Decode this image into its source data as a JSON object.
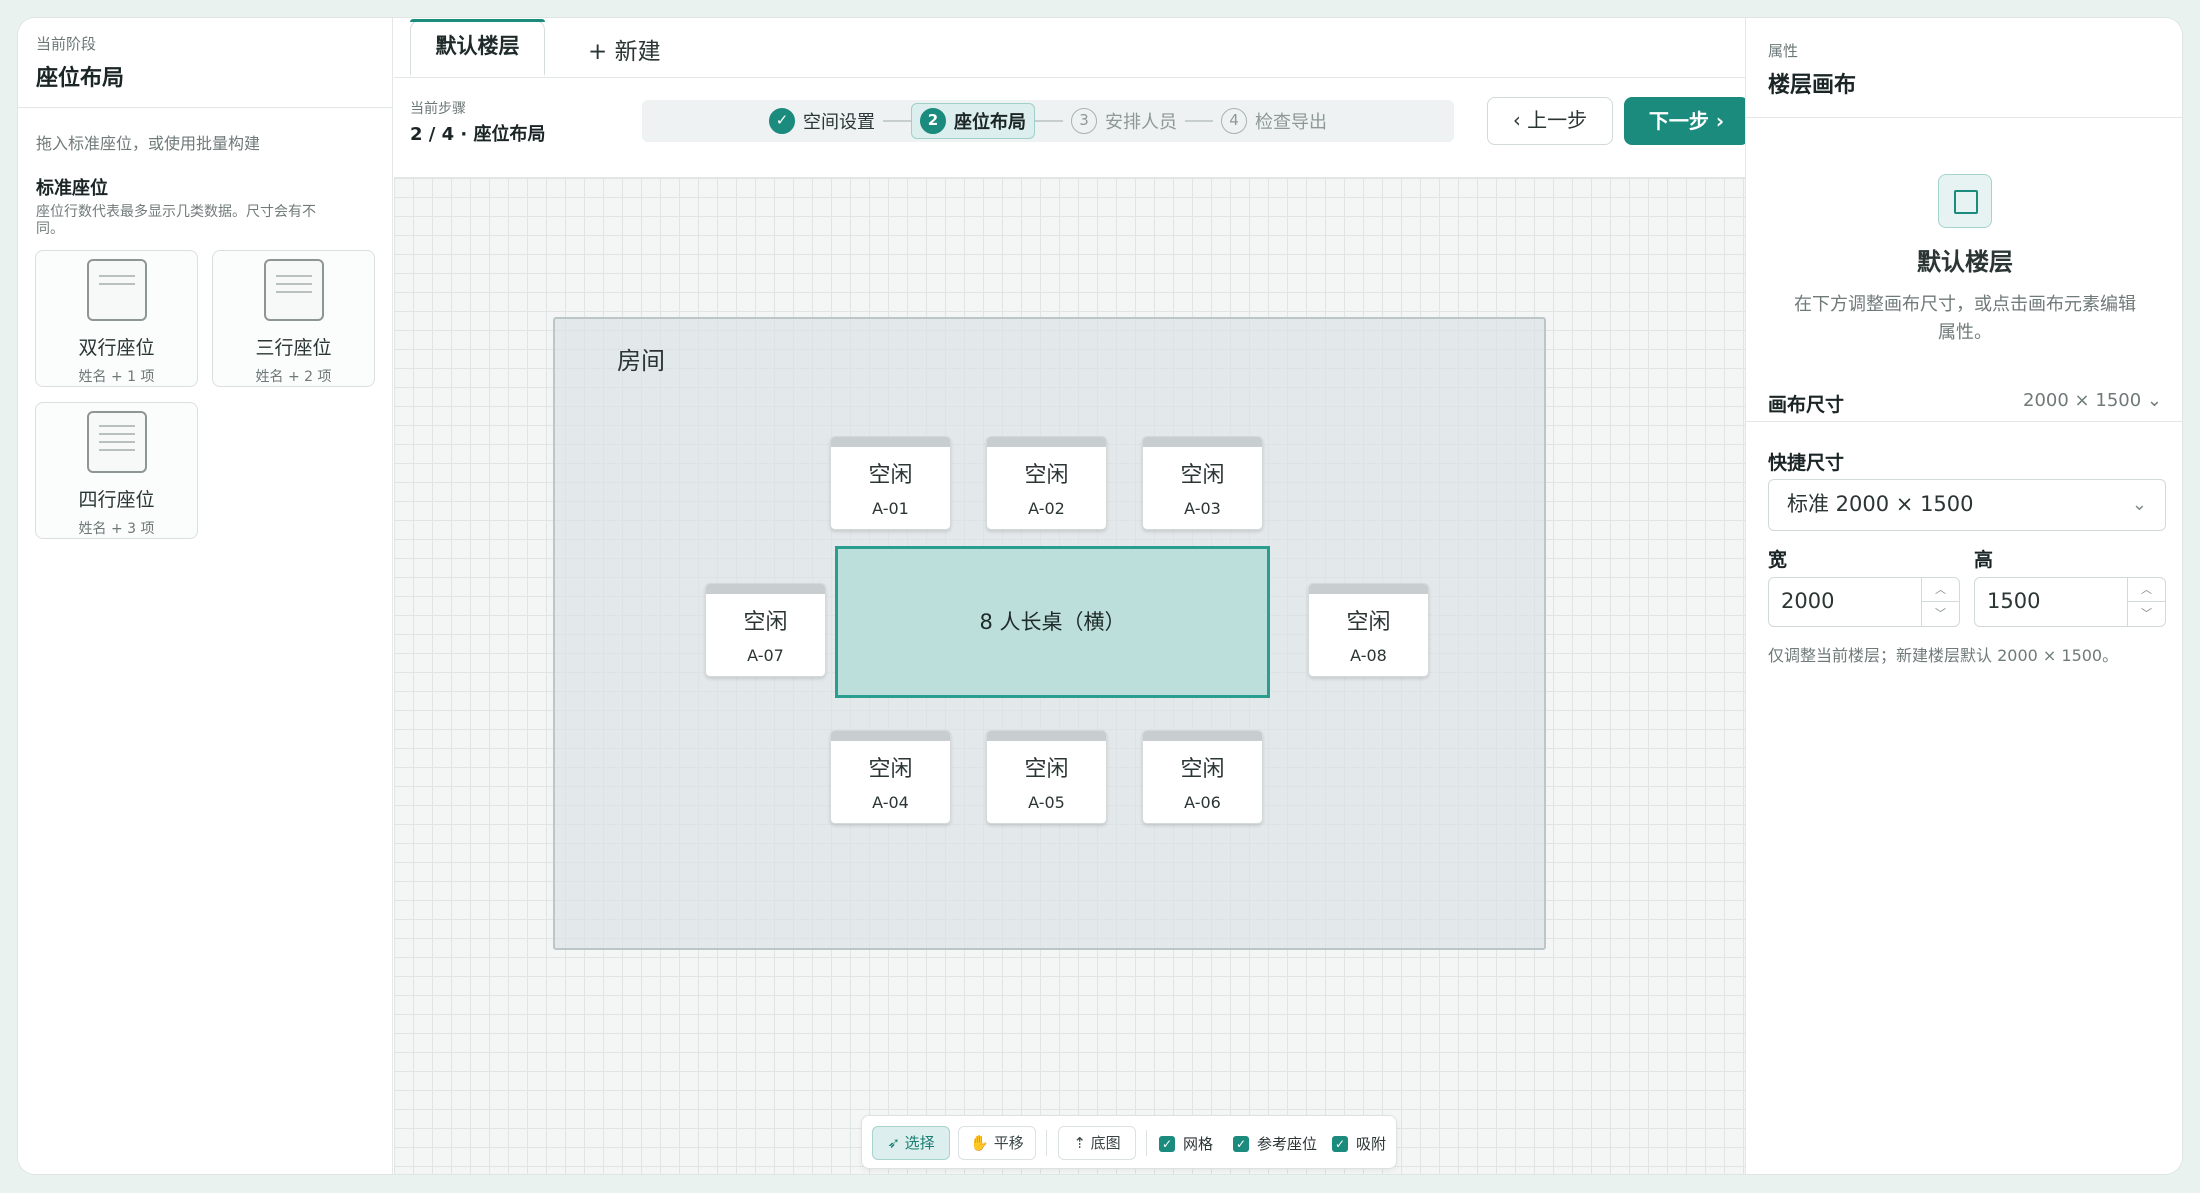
{
  "left": {
    "stage_label": "当前阶段",
    "stage_title": "座位布局",
    "hint": "拖入标准座位，或使用批量构建",
    "section_title": "标准座位",
    "section_desc": "座位行数代表最多显示几类数据。尺寸会有不同。",
    "seat_types": [
      {
        "name": "双行座位",
        "sub": "姓名 + 1 项"
      },
      {
        "name": "三行座位",
        "sub": "姓名 + 2 项"
      },
      {
        "name": "四行座位",
        "sub": "姓名 + 3 项"
      }
    ]
  },
  "tabs": {
    "active": "默认楼层",
    "new": "+ 新建"
  },
  "stepbar": {
    "current_label": "当前步骤",
    "current_value": "2 / 4 · 座位布局",
    "steps": [
      {
        "num": "✓",
        "label": "空间设置",
        "state": "done"
      },
      {
        "num": "2",
        "label": "座位布局",
        "state": "active"
      },
      {
        "num": "3",
        "label": "安排人员",
        "state": "todo"
      },
      {
        "num": "4",
        "label": "检查导出",
        "state": "todo"
      }
    ],
    "prev": "上一步",
    "next": "下一步"
  },
  "canvas": {
    "room_label": "房间",
    "table_label": "8 人长桌（横）",
    "seats": [
      {
        "status": "空闲",
        "id": "A-01"
      },
      {
        "status": "空闲",
        "id": "A-02"
      },
      {
        "status": "空闲",
        "id": "A-03"
      },
      {
        "status": "空闲",
        "id": "A-04"
      },
      {
        "status": "空闲",
        "id": "A-05"
      },
      {
        "status": "空闲",
        "id": "A-06"
      },
      {
        "status": "空闲",
        "id": "A-07"
      },
      {
        "status": "空闲",
        "id": "A-08"
      }
    ]
  },
  "toolbar": {
    "select": "选择",
    "pan": "平移",
    "underlay": "底图",
    "grid": "网格",
    "ref_seats": "参考座位",
    "snap": "吸附"
  },
  "right": {
    "label": "属性",
    "title": "楼层画布",
    "floor_name": "默认楼层",
    "floor_desc": "在下方调整画布尺寸，或点击画布元素编辑属性。",
    "canvas_size_label": "画布尺寸",
    "canvas_size_value": "2000 × 1500",
    "quick_size_label": "快捷尺寸",
    "quick_size_value": "标准 2000 × 1500",
    "width_label": "宽",
    "width_value": "2000",
    "height_label": "高",
    "height_value": "1500",
    "note": "仅调整当前楼层；新建楼层默认 2000 × 1500。"
  },
  "colors": {
    "accent": "#1b8b7e",
    "table_fill": "#bddfdb"
  }
}
